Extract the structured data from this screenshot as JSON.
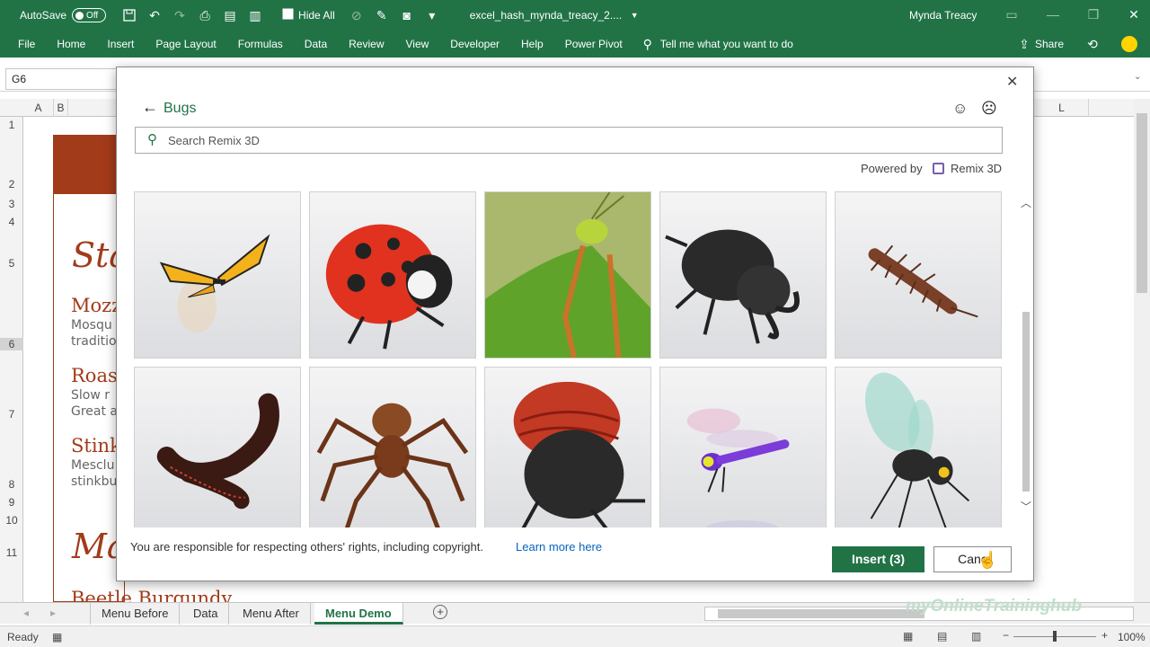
{
  "titlebar": {
    "autosave_label": "AutoSave",
    "autosave_state": "Off",
    "hide_all_label": "Hide All",
    "filename": "excel_hash_mynda_treacy_2....",
    "user": "Mynda Treacy"
  },
  "ribbon": {
    "tabs": [
      "File",
      "Home",
      "Insert",
      "Page Layout",
      "Formulas",
      "Data",
      "Review",
      "View",
      "Developer",
      "Help",
      "Power Pivot"
    ],
    "tell_me": "Tell me what you want to do",
    "share": "Share"
  },
  "formula_bar": {
    "name_box": "G6"
  },
  "columns": [
    "A",
    "B",
    "L"
  ],
  "rows": [
    "1",
    "2",
    "3",
    "4",
    "5",
    "6",
    "7",
    "8",
    "9",
    "10",
    "11"
  ],
  "menu_behind": {
    "title_fragment": "Sta",
    "items": [
      {
        "name": "Mozz",
        "desc1": "Mosqu",
        "desc2": "traditio"
      },
      {
        "name": "Roas",
        "desc1": "Slow r",
        "desc2": "Great a"
      },
      {
        "name": "Stink",
        "desc1": "Mesclu",
        "desc2": "stinkbu"
      }
    ],
    "section2": "Ma",
    "next_item": "Beetle Burgundy"
  },
  "sheet_tabs": [
    "Menu Before",
    "Data",
    "Menu After",
    "Menu Demo"
  ],
  "active_sheet": "Menu Demo",
  "statusbar": {
    "ready": "Ready",
    "zoom": "100%"
  },
  "watermark": "myOnlineTraininghub",
  "dialog": {
    "title": "Bugs",
    "search_placeholder": "Search Remix 3D",
    "powered_by": "Powered by",
    "provider": "Remix 3D",
    "copyright_text": "You are responsible for respecting others' rights, including copyright.",
    "learn_more": "Learn more here",
    "insert_label": "Insert (3)",
    "cancel_label": "Canc",
    "thumbnails": [
      "Butterfly",
      "Ladybug",
      "Praying mantis",
      "Stag beetle",
      "Centipede",
      "Millipede",
      "Spider",
      "Red beetle",
      "Dragonfly",
      "Mosquito"
    ]
  },
  "colors": {
    "excel_green": "#217346",
    "accent_red": "#a23b1a",
    "link_blue": "#0563c1"
  }
}
